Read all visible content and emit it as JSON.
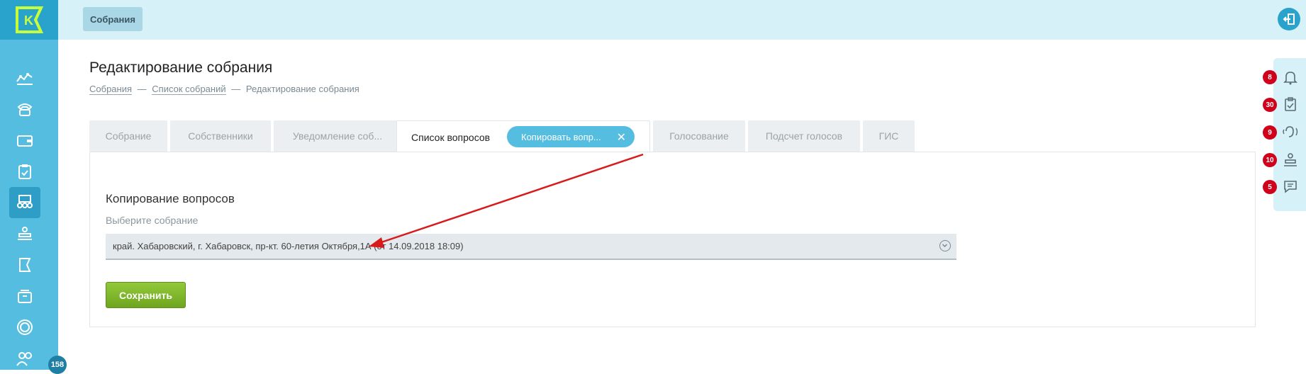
{
  "sidebar": {
    "logo_letter": "K",
    "items": [
      {
        "icon": "analytics-icon"
      },
      {
        "icon": "phone-icon"
      },
      {
        "icon": "wallet-icon"
      },
      {
        "icon": "clipboard-check-icon"
      },
      {
        "icon": "meetings-icon",
        "active": true
      },
      {
        "icon": "inspector-icon"
      },
      {
        "icon": "flag-icon"
      },
      {
        "icon": "archive-icon"
      },
      {
        "icon": "coin-icon"
      },
      {
        "icon": "users-icon"
      }
    ],
    "badge_count": "158"
  },
  "topbar": {
    "chip_label": "Собрания",
    "logout_icon": "logout-icon"
  },
  "page": {
    "title": "Редактирование собрания",
    "breadcrumb": {
      "item1": "Собрания",
      "item2": "Список собраний",
      "current": "Редактирование собрания",
      "separator": "—"
    }
  },
  "tabs": [
    {
      "label": "Собрание"
    },
    {
      "label": "Собственники"
    },
    {
      "label": "Уведомление соб..."
    },
    {
      "label": "Список вопросов",
      "active": true
    },
    {
      "label": "Голосование"
    },
    {
      "label": "Подсчет голосов"
    },
    {
      "label": "ГИС"
    }
  ],
  "subtab": {
    "label": "Копировать вопр...",
    "close": "✕"
  },
  "form": {
    "section_title": "Копирование вопросов",
    "field_label": "Выберите собрание",
    "selected_value": "край. Хабаровский, г. Хабаровск, пр-кт. 60-летия Октября,1А (от 14.09.2018 18:09)",
    "save_label": "Сохранить"
  },
  "notifications": [
    {
      "icon": "bell-icon",
      "count": "8"
    },
    {
      "icon": "clipboard-icon",
      "count": "30"
    },
    {
      "icon": "broadcast-icon",
      "count": "9"
    },
    {
      "icon": "inspector-icon",
      "count": "10"
    },
    {
      "icon": "chat-icon",
      "count": "5"
    }
  ],
  "colors": {
    "sidebar": "#55bde0",
    "accent": "#2aa3cc",
    "save": "#7ab52a",
    "badge": "#d0021b",
    "arrow": "#d91a1a"
  }
}
